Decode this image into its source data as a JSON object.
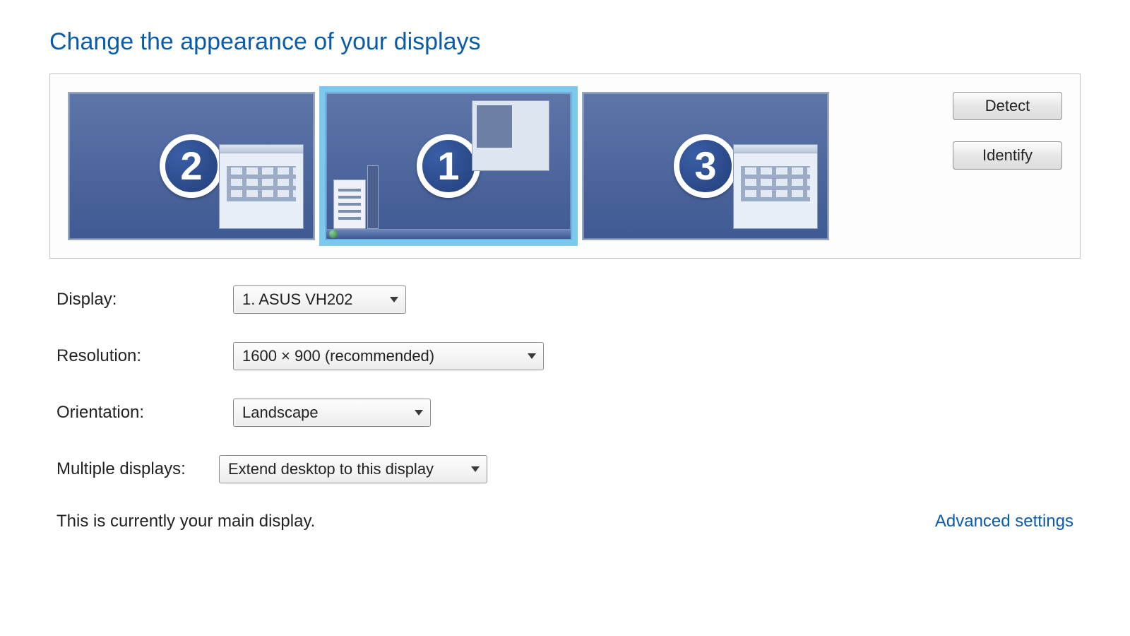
{
  "title": "Change the appearance of your displays",
  "buttons": {
    "detect": "Detect",
    "identify": "Identify"
  },
  "monitors": [
    {
      "label": "2",
      "selected": false
    },
    {
      "label": "1",
      "selected": true
    },
    {
      "label": "3",
      "selected": false
    }
  ],
  "form": {
    "display_label": "Display:",
    "display_value": "1. ASUS VH202",
    "resolution_label": "Resolution:",
    "resolution_value": "1600 × 900 (recommended)",
    "orientation_label": "Orientation:",
    "orientation_value": "Landscape",
    "multiple_label": "Multiple displays:",
    "multiple_value": "Extend desktop to this display"
  },
  "status": "This is currently your main display.",
  "advanced_link": "Advanced settings"
}
